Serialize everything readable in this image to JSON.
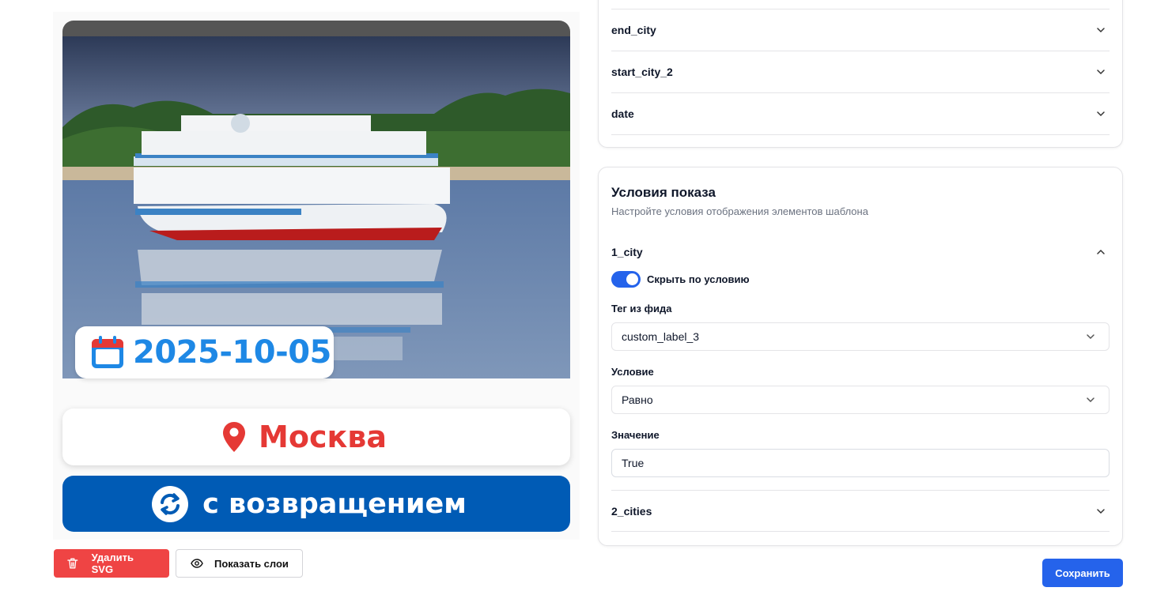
{
  "preview": {
    "date": "2025-10-05",
    "city": "Москва",
    "return_text": "с возвращением",
    "colors": {
      "date": "#1e88e5",
      "city": "#e53935",
      "return_bg": "#005bb5"
    }
  },
  "actions": {
    "delete_svg": "Удалить SVG",
    "show_layers": "Показать слои",
    "save": "Сохранить"
  },
  "variables": {
    "items": [
      {
        "label": "end_city"
      },
      {
        "label": "start_city_2"
      },
      {
        "label": "date"
      }
    ]
  },
  "conditions": {
    "title": "Условия показа",
    "subtitle": "Настройте условия отображения элементов шаблона",
    "expanded_item": {
      "label": "1_city",
      "toggle_label": "Скрыть по условию",
      "toggle_on": true,
      "tag_label": "Тег из фида",
      "tag_value": "custom_label_3",
      "condition_label": "Условие",
      "condition_value": "Равно",
      "value_label": "Значение",
      "value": "True"
    },
    "collapsed_items": [
      {
        "label": "2_cities"
      }
    ]
  }
}
